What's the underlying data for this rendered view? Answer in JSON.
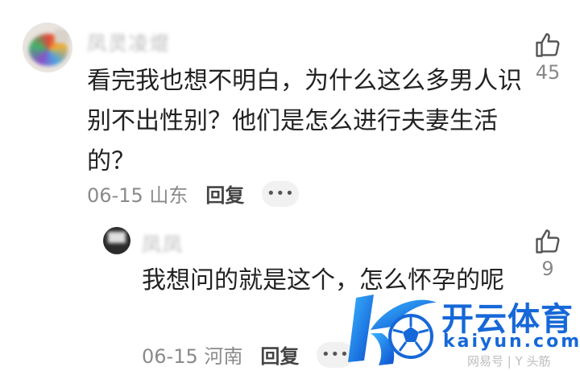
{
  "comment1": {
    "username": "凤灵凌焜",
    "text": "看完我也想不明白，为什么这么多男人识别不出性别？他们是怎么进行夫妻生活的？",
    "date_location": "06-15 山东",
    "reply_label": "回复",
    "more_label": "•••",
    "like_count": "45"
  },
  "comment2": {
    "username": "凤凤",
    "text": "我想问的就是这个，怎么怀孕的呢",
    "date_location": "06-15 河南",
    "reply_label": "回复",
    "more_label": "•••",
    "like_count": "9"
  },
  "watermark": {
    "brand": "开云体育",
    "domain": "kaiyun.com",
    "attribution": "网易号 | Y 头筋"
  },
  "colors": {
    "text": "#222222",
    "meta": "#8a8a8a",
    "brand_blue": "#1668d8"
  }
}
